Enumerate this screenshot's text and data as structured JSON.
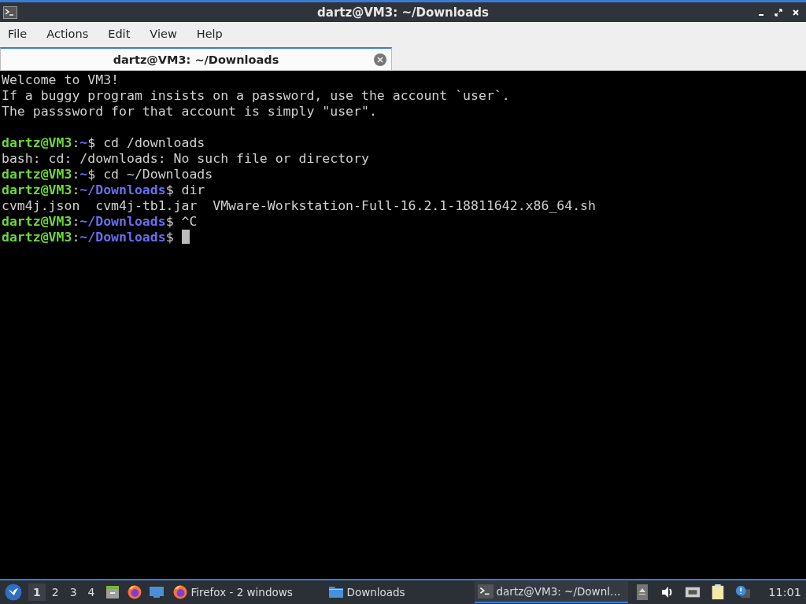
{
  "window": {
    "title": "dartz@VM3: ~/Downloads"
  },
  "menu": [
    "File",
    "Actions",
    "Edit",
    "View",
    "Help"
  ],
  "tabs": [
    {
      "label": "dartz@VM3: ~/Downloads",
      "selected": true
    }
  ],
  "terminal": {
    "lines": [
      {
        "kind": "text",
        "segments": [
          {
            "kind": "plain",
            "text": "Welcome to VM3!"
          }
        ]
      },
      {
        "kind": "text",
        "segments": [
          {
            "kind": "plain",
            "text": "If a buggy program insists on a password, use the account `user`."
          }
        ]
      },
      {
        "kind": "text",
        "segments": [
          {
            "kind": "plain",
            "text": "The passsword for that account is simply \"user\"."
          }
        ]
      },
      {
        "kind": "blank"
      },
      {
        "kind": "text",
        "segments": [
          {
            "kind": "user",
            "text": "dartz@VM3"
          },
          {
            "kind": "plain",
            "text": ":"
          },
          {
            "kind": "path",
            "text": "~"
          },
          {
            "kind": "plain",
            "text": "$ cd /downloads"
          }
        ]
      },
      {
        "kind": "text",
        "segments": [
          {
            "kind": "plain",
            "text": "bash: cd: /downloads: No such file or directory"
          }
        ]
      },
      {
        "kind": "text",
        "segments": [
          {
            "kind": "user",
            "text": "dartz@VM3"
          },
          {
            "kind": "plain",
            "text": ":"
          },
          {
            "kind": "path",
            "text": "~"
          },
          {
            "kind": "plain",
            "text": "$ cd ~/Downloads"
          }
        ]
      },
      {
        "kind": "text",
        "segments": [
          {
            "kind": "user",
            "text": "dartz@VM3"
          },
          {
            "kind": "plain",
            "text": ":"
          },
          {
            "kind": "path",
            "text": "~/Downloads"
          },
          {
            "kind": "plain",
            "text": "$ dir"
          }
        ]
      },
      {
        "kind": "text",
        "segments": [
          {
            "kind": "plain",
            "text": "cvm4j.json  cvm4j-tb1.jar  VMware-Workstation-Full-16.2.1-18811642.x86_64.sh"
          }
        ]
      },
      {
        "kind": "text",
        "segments": [
          {
            "kind": "user",
            "text": "dartz@VM3"
          },
          {
            "kind": "plain",
            "text": ":"
          },
          {
            "kind": "path",
            "text": "~/Downloads"
          },
          {
            "kind": "plain",
            "text": "$ ^C"
          }
        ]
      },
      {
        "kind": "text",
        "segments": [
          {
            "kind": "user",
            "text": "dartz@VM3"
          },
          {
            "kind": "plain",
            "text": ":"
          },
          {
            "kind": "path",
            "text": "~/Downloads"
          },
          {
            "kind": "plain",
            "text": "$ "
          }
        ],
        "cursor": true
      }
    ]
  },
  "taskbar": {
    "workspaces": [
      {
        "label": "1",
        "selected": true
      },
      {
        "label": "2",
        "selected": false
      },
      {
        "label": "3",
        "selected": false
      },
      {
        "label": "4",
        "selected": false
      }
    ],
    "tasks": [
      {
        "kind": "firefox",
        "label": "Firefox - 2 windows",
        "selected": false
      },
      {
        "kind": "folder",
        "label": "Downloads",
        "selected": false
      },
      {
        "kind": "terminal",
        "label": "dartz@VM3: ~/Downl…",
        "selected": true
      }
    ],
    "clock": "11:01"
  }
}
